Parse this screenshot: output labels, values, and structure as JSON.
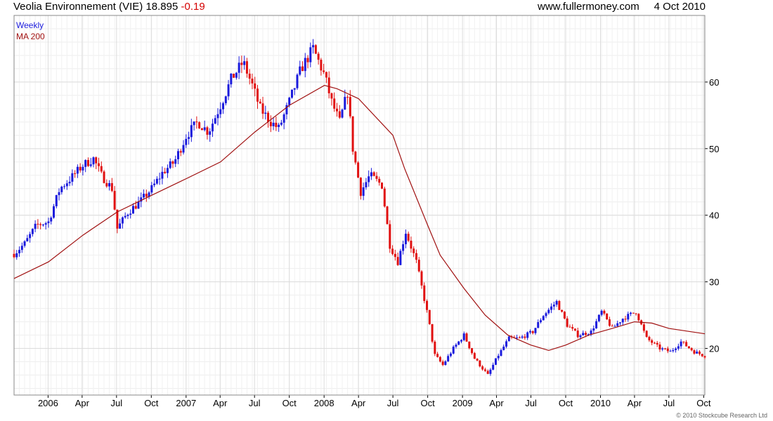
{
  "header": {
    "name": "Veolia Environnement (VIE)",
    "price": "18.895",
    "change": "-0.19",
    "site": "www.fullermoney.com",
    "date": "4 Oct 2010"
  },
  "legend": {
    "weekly": "Weekly",
    "ma": "MA 200"
  },
  "copyright": "© 2010 Stockcube Research Ltd",
  "colors": {
    "up": "#1a1adc",
    "down": "#e01010",
    "ma": "#a01010",
    "grid": "#dcdcdc",
    "axis": "#000000"
  },
  "chart_data": {
    "type": "candlestick",
    "title": "Veolia Environnement (VIE)",
    "frequency": "Weekly",
    "x_range": [
      "2005-10-03",
      "2010-10-04"
    ],
    "ylim": [
      13,
      70
    ],
    "y_ticks": [
      20,
      30,
      40,
      50,
      60
    ],
    "x_ticks": [
      {
        "label": "2006",
        "date": "2006-01-01"
      },
      {
        "label": "Apr",
        "date": "2006-04-01"
      },
      {
        "label": "Jul",
        "date": "2006-07-01"
      },
      {
        "label": "Oct",
        "date": "2006-10-01"
      },
      {
        "label": "2007",
        "date": "2007-01-01"
      },
      {
        "label": "Apr",
        "date": "2007-04-01"
      },
      {
        "label": "Jul",
        "date": "2007-07-01"
      },
      {
        "label": "Oct",
        "date": "2007-10-01"
      },
      {
        "label": "2008",
        "date": "2008-01-01"
      },
      {
        "label": "Apr",
        "date": "2008-04-01"
      },
      {
        "label": "Jul",
        "date": "2008-07-01"
      },
      {
        "label": "Oct",
        "date": "2008-10-01"
      },
      {
        "label": "2009",
        "date": "2009-01-01"
      },
      {
        "label": "Apr",
        "date": "2009-04-01"
      },
      {
        "label": "Jul",
        "date": "2009-07-01"
      },
      {
        "label": "Oct",
        "date": "2009-10-01"
      },
      {
        "label": "2010",
        "date": "2010-01-01"
      },
      {
        "label": "Apr",
        "date": "2010-04-01"
      },
      {
        "label": "Jul",
        "date": "2010-07-01"
      },
      {
        "label": "Oct",
        "date": "2010-10-01"
      }
    ],
    "series": [
      {
        "name": "Weekly",
        "kind": "close",
        "points": [
          [
            "2005-10-03",
            34.2
          ],
          [
            "2005-11-01",
            35.8
          ],
          [
            "2005-12-01",
            38.5
          ],
          [
            "2006-01-02",
            39.0
          ],
          [
            "2006-02-01",
            44.0
          ],
          [
            "2006-03-01",
            45.5
          ],
          [
            "2006-04-03",
            47.5
          ],
          [
            "2006-05-01",
            48.5
          ],
          [
            "2006-05-22",
            46.0
          ],
          [
            "2006-06-19",
            44.0
          ],
          [
            "2006-07-03",
            38.0
          ],
          [
            "2006-08-01",
            40.5
          ],
          [
            "2006-09-01",
            42.0
          ],
          [
            "2006-10-02",
            44.0
          ],
          [
            "2006-11-01",
            46.5
          ],
          [
            "2006-12-01",
            48.0
          ],
          [
            "2007-01-02",
            52.0
          ],
          [
            "2007-02-01",
            54.0
          ],
          [
            "2007-03-01",
            52.5
          ],
          [
            "2007-04-02",
            56.5
          ],
          [
            "2007-05-01",
            60.5
          ],
          [
            "2007-06-01",
            63.0
          ],
          [
            "2007-06-25",
            59.5
          ],
          [
            "2007-07-16",
            56.0
          ],
          [
            "2007-08-13",
            54.0
          ],
          [
            "2007-09-03",
            53.0
          ],
          [
            "2007-10-01",
            57.0
          ],
          [
            "2007-11-01",
            62.0
          ],
          [
            "2007-12-03",
            65.0
          ],
          [
            "2008-01-02",
            61.0
          ],
          [
            "2008-01-21",
            57.0
          ],
          [
            "2008-02-11",
            54.0
          ],
          [
            "2008-03-03",
            58.5
          ],
          [
            "2008-03-17",
            50.0
          ],
          [
            "2008-04-07",
            43.5
          ],
          [
            "2008-05-01",
            46.0
          ],
          [
            "2008-06-02",
            44.5
          ],
          [
            "2008-06-23",
            35.5
          ],
          [
            "2008-07-14",
            33.0
          ],
          [
            "2008-08-04",
            37.5
          ],
          [
            "2008-09-01",
            33.0
          ],
          [
            "2008-10-01",
            25.0
          ],
          [
            "2008-10-20",
            19.0
          ],
          [
            "2008-11-10",
            17.5
          ],
          [
            "2008-12-08",
            20.0
          ],
          [
            "2009-01-05",
            22.0
          ],
          [
            "2009-02-02",
            18.5
          ],
          [
            "2009-03-09",
            16.0
          ],
          [
            "2009-04-06",
            19.0
          ],
          [
            "2009-05-04",
            21.5
          ],
          [
            "2009-06-01",
            21.5
          ],
          [
            "2009-07-06",
            22.5
          ],
          [
            "2009-08-03",
            25.0
          ],
          [
            "2009-09-07",
            27.0
          ],
          [
            "2009-10-05",
            23.5
          ],
          [
            "2009-11-02",
            22.0
          ],
          [
            "2009-12-07",
            22.5
          ],
          [
            "2010-01-04",
            25.5
          ],
          [
            "2010-02-01",
            23.0
          ],
          [
            "2010-03-01",
            24.5
          ],
          [
            "2010-04-05",
            25.5
          ],
          [
            "2010-05-03",
            21.5
          ],
          [
            "2010-06-07",
            20.0
          ],
          [
            "2010-07-05",
            19.5
          ],
          [
            "2010-08-02",
            21.0
          ],
          [
            "2010-09-06",
            19.5
          ],
          [
            "2010-10-04",
            18.9
          ]
        ]
      },
      {
        "name": "MA 200",
        "kind": "line",
        "points": [
          [
            "2005-10-03",
            30.5
          ],
          [
            "2006-01-02",
            33.0
          ],
          [
            "2006-04-03",
            37.0
          ],
          [
            "2006-07-03",
            40.5
          ],
          [
            "2006-10-02",
            43.0
          ],
          [
            "2007-01-02",
            45.5
          ],
          [
            "2007-04-02",
            48.0
          ],
          [
            "2007-07-02",
            52.5
          ],
          [
            "2007-10-01",
            56.5
          ],
          [
            "2008-01-02",
            59.5
          ],
          [
            "2008-02-04",
            59.0
          ],
          [
            "2008-04-01",
            57.5
          ],
          [
            "2008-07-01",
            52.0
          ],
          [
            "2008-08-01",
            47.0
          ],
          [
            "2008-10-01",
            38.5
          ],
          [
            "2008-11-03",
            34.0
          ],
          [
            "2009-01-05",
            29.0
          ],
          [
            "2009-03-02",
            25.0
          ],
          [
            "2009-05-01",
            22.0
          ],
          [
            "2009-07-01",
            20.5
          ],
          [
            "2009-08-17",
            19.7
          ],
          [
            "2009-10-01",
            20.5
          ],
          [
            "2009-12-01",
            22.0
          ],
          [
            "2010-02-01",
            23.0
          ],
          [
            "2010-04-01",
            24.0
          ],
          [
            "2010-05-17",
            23.8
          ],
          [
            "2010-07-01",
            23.0
          ],
          [
            "2010-10-04",
            22.2
          ]
        ]
      }
    ]
  }
}
